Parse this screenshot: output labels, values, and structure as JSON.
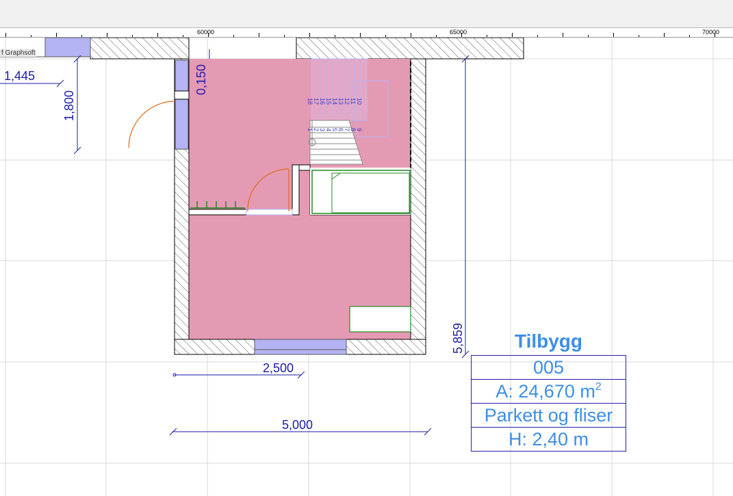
{
  "ruler": {
    "labels": [
      "60000",
      "65000",
      "70000"
    ]
  },
  "layer_tag": "f Graphsoft",
  "dimensions": {
    "d1445": "1,445",
    "d1800": "1,800",
    "d0150": "0,150",
    "d5859": "5,859",
    "d2500": "2,500",
    "d5000": "5,000"
  },
  "stairs": {
    "upper_numbers": [
      "18",
      "17",
      "16",
      "15",
      "14",
      "13",
      "12",
      "11",
      "10"
    ],
    "lower_numbers": [
      "1",
      "2",
      "3",
      "4",
      "5",
      "6",
      "7",
      "8",
      "9"
    ]
  },
  "zone_stamp": {
    "name": "Tilbygg",
    "number": "005",
    "area_prefix": "A: 24,670 m",
    "area_sup": "2",
    "material": "Parkett og fliser",
    "height": "H: 2,40 m"
  },
  "colors": {
    "room_fill": "#e59ab4",
    "wall_hatch": "#555555",
    "window": "#b4b4f4",
    "door_swing": "#e06a1a",
    "furniture": "#228822",
    "dimension": "#1a1aa8",
    "stamp_text": "#3e8ee6",
    "grid": "#d9d9d9"
  }
}
